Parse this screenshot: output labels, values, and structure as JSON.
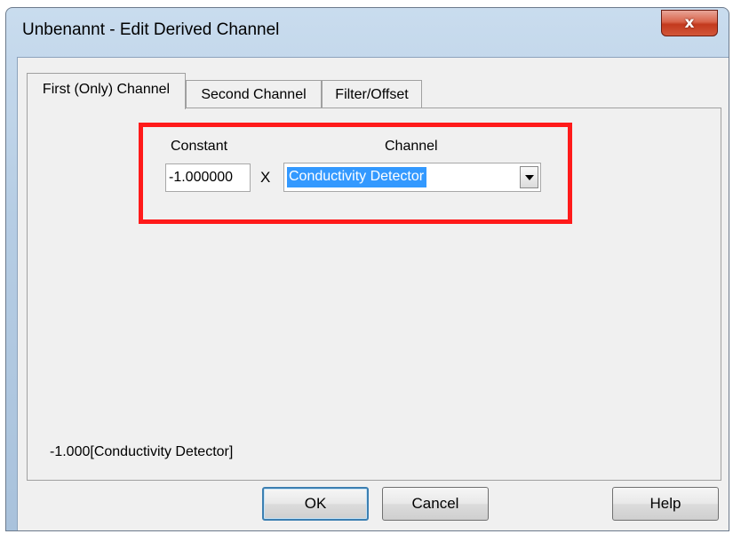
{
  "window": {
    "title": "Unbenannt - Edit Derived Channel",
    "close_glyph": "x",
    "close_icon": "close-icon",
    "highlight_color": "#ff1a1a",
    "selection_color": "#3399ff"
  },
  "tabs": [
    {
      "label": "First (Only) Channel",
      "active": true
    },
    {
      "label": "Second Channel",
      "active": false
    },
    {
      "label": "Filter/Offset",
      "active": false
    }
  ],
  "first_channel": {
    "constant_label": "Constant",
    "constant_value": "-1.000000",
    "multiply_symbol": "X",
    "channel_label": "Channel",
    "channel_value": "Conductivity Detector",
    "channel_dropdown_icon": "chevron-down-icon"
  },
  "formula": "-1.000[Conductivity Detector]",
  "buttons": {
    "ok": "OK",
    "cancel": "Cancel",
    "help": "Help"
  }
}
